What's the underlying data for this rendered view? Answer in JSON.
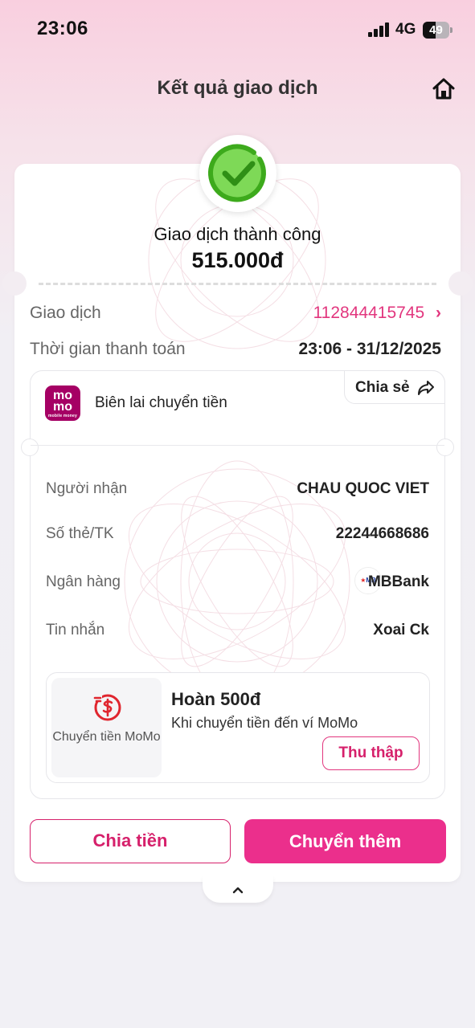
{
  "status_bar": {
    "time": "23:06",
    "network": "4G",
    "battery": "49",
    "battery_level": 0.49
  },
  "header": {
    "title": "Kết quả giao dịch",
    "home_icon": "home-icon"
  },
  "result": {
    "status_text": "Giao dịch thành công",
    "amount": "515.000đ",
    "success_color": "#52c41a"
  },
  "transaction": {
    "id_label": "Giao dịch",
    "id_value": "112844415745",
    "time_label": "Thời gian thanh toán",
    "time_value": "23:06 - 31/12/2025"
  },
  "receipt": {
    "title": "Biên lai chuyển tiền",
    "share_label": "Chia sẻ",
    "logo_text_top": "mo",
    "logo_text_bottom": "mo",
    "logo_caption": "mobile money",
    "details": [
      {
        "label": "Người nhận",
        "value": "CHAU QUOC VIET"
      },
      {
        "label": "Số thẻ/TK",
        "value": "22244668686"
      },
      {
        "label": "Ngân hàng",
        "value": "MBBank"
      },
      {
        "label": "Tin nhắn",
        "value": "Xoai Ck"
      }
    ],
    "bank_logo_text": "MB"
  },
  "promo": {
    "left_label": "Chuyển tiền MoMo",
    "title": "Hoàn 500đ",
    "subtitle": "Khi chuyển tiền đến ví MoMo",
    "button": "Thu thập"
  },
  "actions": {
    "split": "Chia tiền",
    "send_more": "Chuyển thêm"
  },
  "colors": {
    "brand_pink": "#eb2f8c",
    "momo_purple": "#a50064"
  }
}
